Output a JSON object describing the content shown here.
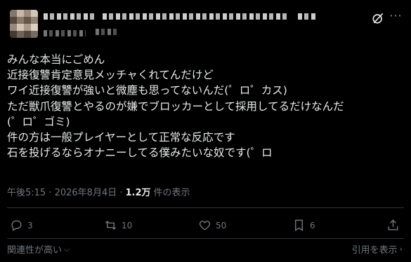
{
  "tweet": {
    "author_display_name": "",
    "author_handle": "",
    "lines": [
      "みんな本当にごめん",
      "近接復讐肯定意見メッチャくれてんだけど",
      "ワイ近接復讐が強いと微塵も思ってないんだ(゜ロ゜カス)",
      "ただ獣爪復讐とやるのが嫌でブロッカーとして採用してるだけなんだ",
      "(゜ロ゜ゴミ)",
      "件の方は一般プレイヤーとして正常な反応です",
      "石を投げるならオナニーしてる僕みたいな奴です(゜ロ"
    ],
    "timestamp": "午後5:15 · 2026年8月4日 · ",
    "views_count": "1.2万",
    "views_label": "件の表示",
    "replies": "3",
    "reposts": "10",
    "likes": "50",
    "bookmarks": "6"
  },
  "footer": {
    "left_label": "関連性が高い",
    "right_label": "引用を表示"
  },
  "icons": [
    "avatar",
    "grok-icon",
    "more-icon",
    "reply-icon",
    "repost-icon",
    "like-icon",
    "bookmark-icon",
    "share-icon",
    "chevron-down-icon",
    "chevron-right-icon"
  ]
}
